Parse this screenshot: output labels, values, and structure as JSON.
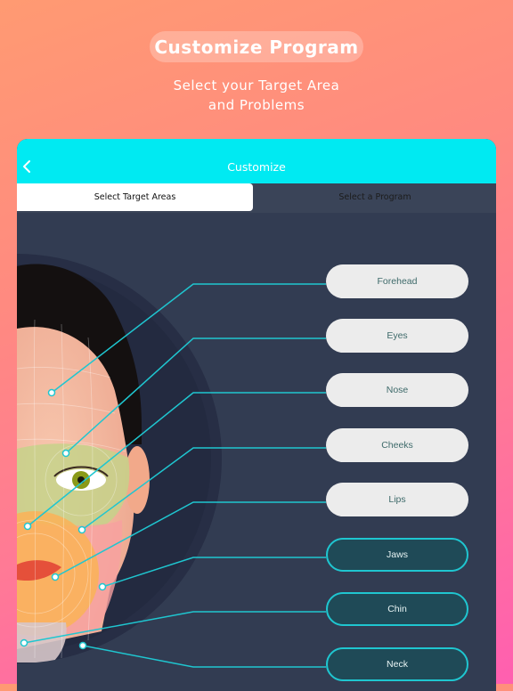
{
  "hero": {
    "title": "Customize Program",
    "subtitle_line1": "Select your Target Area",
    "subtitle_line2": "and Problems"
  },
  "header": {
    "back_icon": "chevron-left-icon",
    "title": "Customize"
  },
  "tabs": [
    {
      "label": "Select Target Areas",
      "active": true
    },
    {
      "label": "Select a Program",
      "active": false
    }
  ],
  "areas": [
    {
      "label": "Forehead",
      "selected": false
    },
    {
      "label": "Eyes",
      "selected": false
    },
    {
      "label": "Nose",
      "selected": false
    },
    {
      "label": "Cheeks",
      "selected": false
    },
    {
      "label": "Lips",
      "selected": false
    },
    {
      "label": "Jaws",
      "selected": true
    },
    {
      "label": "Chin",
      "selected": true
    },
    {
      "label": "Neck",
      "selected": true
    }
  ],
  "colors": {
    "accent": "#00eaf2",
    "line": "#1fc6d0",
    "card_bg": "#323c52",
    "pill_light": "#ececec",
    "pill_dark": "#1f4a57"
  }
}
